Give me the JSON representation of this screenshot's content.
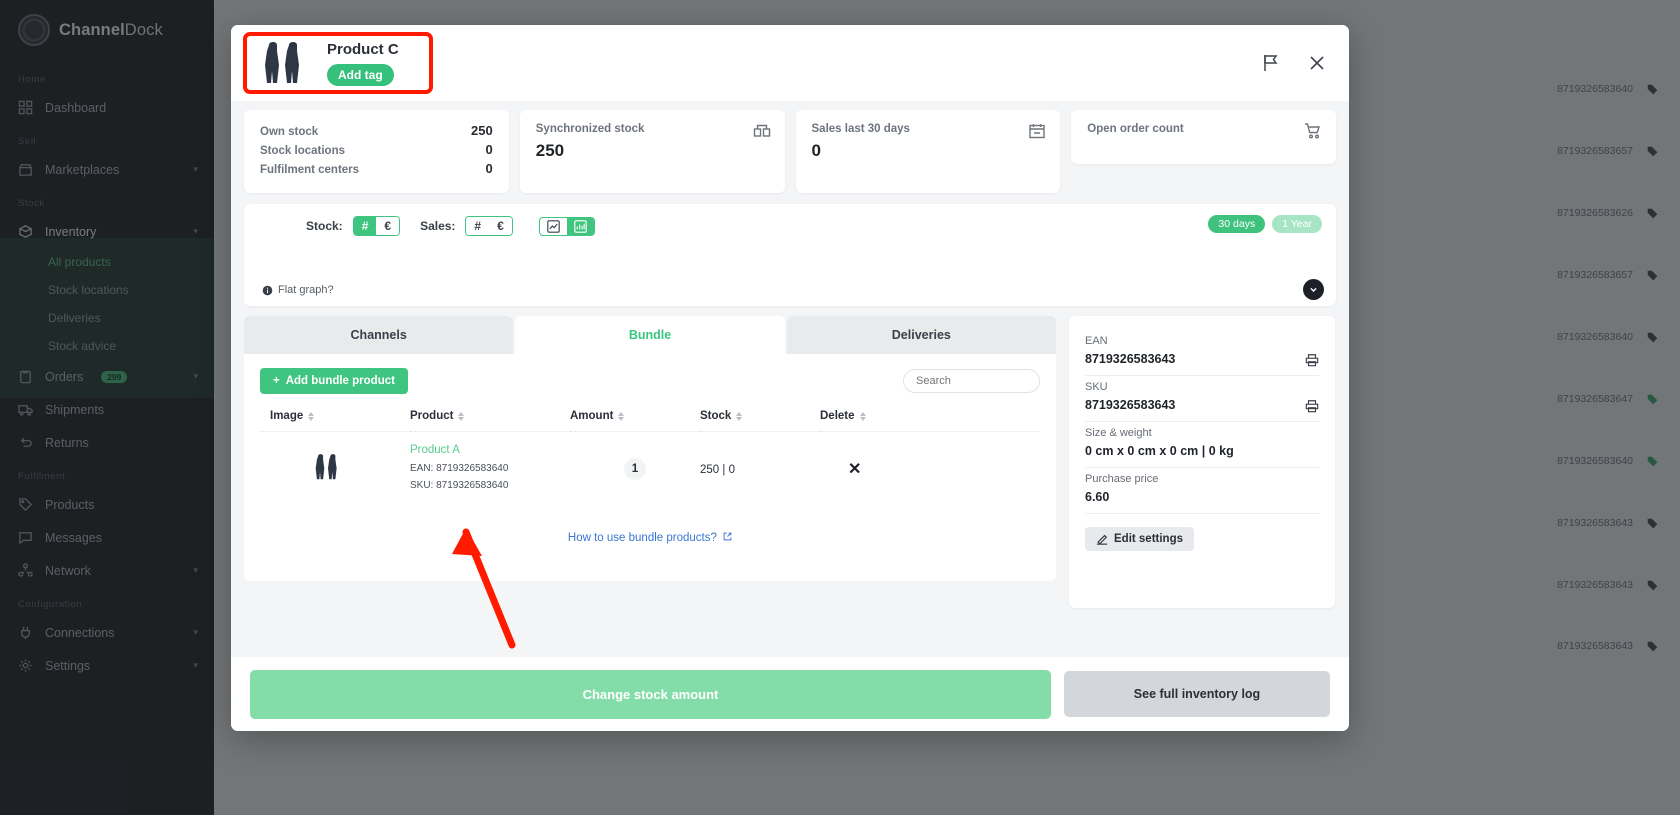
{
  "sidebar": {
    "brand_bold": "Channel",
    "brand_thin": "Dock",
    "sections": [
      {
        "label": "Home",
        "items": [
          {
            "label": "Dashboard",
            "icon": "grid-icon"
          }
        ]
      },
      {
        "label": "Sell",
        "items": [
          {
            "label": "Marketplaces",
            "icon": "store-icon",
            "caret": "▾"
          }
        ]
      },
      {
        "label": "Stock",
        "items": [
          {
            "label": "Inventory",
            "icon": "box-icon",
            "caret": "▾"
          }
        ]
      },
      {
        "label": "Fulfilment",
        "items": [
          {
            "label": "Products",
            "icon": "tag-icon"
          },
          {
            "label": "Messages",
            "icon": "chat-icon"
          },
          {
            "label": "Network",
            "icon": "network-icon",
            "caret": "▾"
          }
        ]
      },
      {
        "label": "Configuration",
        "items": [
          {
            "label": "Connections",
            "icon": "plug-icon",
            "caret": "▾"
          },
          {
            "label": "Settings",
            "icon": "gear-icon",
            "caret": "▾"
          }
        ]
      }
    ],
    "inventory_subitems": [
      {
        "label": "All products",
        "active": true
      },
      {
        "label": "Stock locations",
        "active": false
      },
      {
        "label": "Deliveries",
        "active": false
      },
      {
        "label": "Stock advice",
        "active": false
      }
    ],
    "orders": {
      "label": "Orders",
      "badge": "299",
      "caret": "▾"
    },
    "shipments": {
      "label": "Shipments"
    },
    "returns": {
      "label": "Returns"
    }
  },
  "background_rows": [
    {
      "code": "8719326583640"
    },
    {
      "code": "8719326583657"
    },
    {
      "code": "8719326583626"
    },
    {
      "code": "8719326583657"
    },
    {
      "code": "8719326583640"
    },
    {
      "code": "8719326583647"
    },
    {
      "code": "8719326583640"
    },
    {
      "code": "8719326583643"
    },
    {
      "code": "8719326583643"
    },
    {
      "code": "8719326583643"
    }
  ],
  "modal": {
    "header": {
      "product_title": "Product C",
      "add_tag_label": "Add tag",
      "flag_icon": "flag-icon",
      "close_icon": "close-icon"
    },
    "stats": {
      "own_stock_label": "Own stock",
      "own_stock_value": "250",
      "stock_locations_label": "Stock locations",
      "stock_locations_value": "0",
      "fulfilment_centers_label": "Fulfilment centers",
      "fulfilment_centers_value": "0",
      "synchronized_stock_label": "Synchronized stock",
      "synchronized_stock_value": "250",
      "synchronized_icon": "package-icon",
      "sales_30_label": "Sales last 30 days",
      "sales_30_value": "0",
      "sales_icon": "calendar-icon",
      "open_orders_label": "Open order count",
      "open_orders_icon": "cart-icon"
    },
    "graph": {
      "stock_label": "Stock:",
      "stock_hash": "#",
      "stock_euro": "€",
      "sales_label": "Sales:",
      "sales_hash": "#",
      "sales_euro": "€",
      "line_chart_icon": "line-chart-icon",
      "bar_chart_icon": "bar-chart-icon",
      "pill_30_days": "30 days",
      "pill_1_year": "1 Year",
      "flat_graph_label": "Flat graph?",
      "info_icon": "info-icon",
      "expand_icon": "chevron-down-icon"
    },
    "tabs": [
      {
        "label": "Channels",
        "active": false
      },
      {
        "label": "Bundle",
        "active": true
      },
      {
        "label": "Deliveries",
        "active": false
      }
    ],
    "bundle": {
      "add_button_label": "Add bundle product",
      "search_placeholder": "Search",
      "columns": [
        "Image",
        "Product",
        "Amount",
        "Stock",
        "Delete"
      ],
      "rows": [
        {
          "product": "Product A",
          "ean": "EAN: 8719326583640",
          "sku": "SKU: 8719326583640",
          "amount": "1",
          "stock": "250 | 0",
          "delete": "✕"
        }
      ],
      "how_to_label": "How to use bundle products?"
    },
    "info": {
      "ean_label": "EAN",
      "ean_value": "8719326583643",
      "sku_label": "SKU",
      "sku_value": "8719326583643",
      "size_label": "Size & weight",
      "size_value": "0 cm x 0 cm x 0 cm | 0 kg",
      "price_label": "Purchase price",
      "price_value": "6.60",
      "edit_label": "Edit settings",
      "edit_icon": "ruler-icon",
      "print_icon": "printer-icon"
    },
    "footer": {
      "change_stock_label": "Change stock amount",
      "inventory_log_label": "See full inventory log"
    }
  },
  "colors": {
    "accent_green": "#3fc57f",
    "light_green": "#84dda9",
    "sidebar_bg": "#14161a",
    "annotation_red": "#ff1a00",
    "link_blue": "#3876d1"
  }
}
